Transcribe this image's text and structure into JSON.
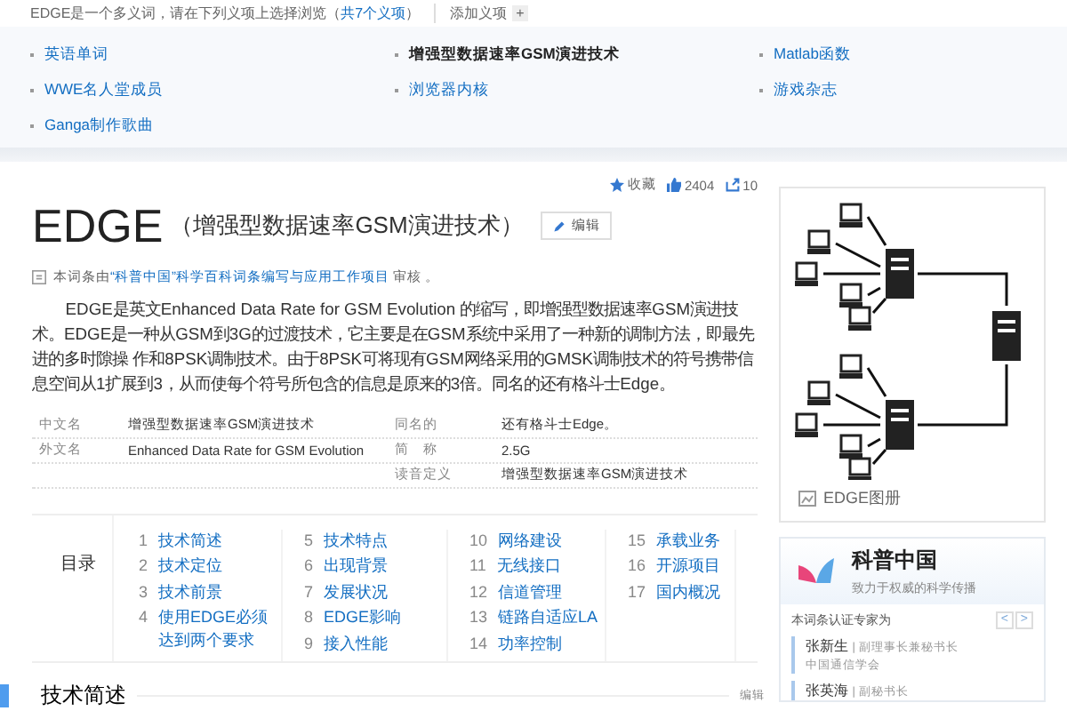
{
  "disambiguation_bar": {
    "prefix": "EDGE是一个多义词，请在下列义项上选择浏览（",
    "count": "共7个义项",
    "suffix": "）",
    "add_label": "添加义项",
    "add_icon": "+"
  },
  "senses": [
    {
      "label": "英语单词",
      "selected": false
    },
    {
      "label": "增强型数据速率GSM演进技术",
      "selected": true
    },
    {
      "label": "Matlab函数",
      "selected": false
    },
    {
      "label": "WWE名人堂成员",
      "selected": false
    },
    {
      "label": "浏览器内核",
      "selected": false
    },
    {
      "label": "游戏杂志",
      "selected": false
    },
    {
      "label": "Ganga制作歌曲",
      "selected": false
    }
  ],
  "stats": {
    "favorite": "收藏",
    "likes": "2404",
    "shares": "10"
  },
  "title": {
    "main": "EDGE",
    "subtitle": "（增强型数据速率GSM演进技术）",
    "edit": "编辑"
  },
  "review": {
    "prefix": "本词条由",
    "link": "“科普中国”科学百科词条编写与应用工作项目",
    "suffix": " 审核 。"
  },
  "summary": "EDGE是英文Enhanced Data Rate for GSM Evolution 的缩写，即增强型数据速率GSM演进技术。EDGE是一种从GSM到3G的过渡技术，它主要是在GSM系统中采用了一种新的调制方法，即最先进的多时隙操 作和8PSK调制技术。由于8PSK可将现有GSM网络采用的GMSK调制技术的符号携带信息空间从1扩展到3，从而使每个符号所包含的信息是原来的3倍。同名的还有格斗士Edge。",
  "infobox": [
    {
      "left": {
        "label": "中文名",
        "value": "增强型数据速率GSM演进技术"
      },
      "right": {
        "label": "同名的",
        "value": "还有格斗士Edge。"
      }
    },
    {
      "left": {
        "label": "外文名",
        "value": "Enhanced Data Rate for GSM Evolution"
      },
      "right": {
        "label": "简　称",
        "value": "2.5G"
      }
    },
    {
      "right": {
        "label": "读音定义",
        "value": "增强型数据速率GSM演进技术"
      }
    }
  ],
  "gallery": {
    "caption": "EDGE图册"
  },
  "toc": {
    "title": "目录",
    "columns": [
      [
        {
          "num": "1",
          "label": "技术简述"
        },
        {
          "num": "2",
          "label": "技术定位"
        },
        {
          "num": "3",
          "label": "技术前景"
        },
        {
          "num": "4",
          "label": "使用EDGE必须达到两个要求"
        }
      ],
      [
        {
          "num": "5",
          "label": "技术特点"
        },
        {
          "num": "6",
          "label": "出现背景"
        },
        {
          "num": "7",
          "label": "发展状况"
        },
        {
          "num": "8",
          "label": "EDGE影响"
        },
        {
          "num": "9",
          "label": "接入性能"
        }
      ],
      [
        {
          "num": "10",
          "label": "网络建设"
        },
        {
          "num": "11",
          "label": "无线接口"
        },
        {
          "num": "12",
          "label": "信道管理"
        },
        {
          "num": "13",
          "label": "链路自适应LA"
        },
        {
          "num": "14",
          "label": "功率控制"
        }
      ],
      [
        {
          "num": "15",
          "label": "承载业务"
        },
        {
          "num": "16",
          "label": "开源项目"
        },
        {
          "num": "17",
          "label": "国内概况"
        }
      ]
    ]
  },
  "section": {
    "title": "技术简述",
    "edit": "编辑"
  },
  "partner": {
    "name": "科普中国",
    "slogan": "致力于权威的科学传播",
    "experts_label": "本词条认证专家为",
    "separator": "|",
    "prev": "<",
    "next": ">",
    "experts": [
      {
        "name": "张新生",
        "role": "副理事长兼秘书长",
        "org": "中国通信学会"
      },
      {
        "name": "张英海",
        "role": "副秘书长"
      }
    ]
  }
}
